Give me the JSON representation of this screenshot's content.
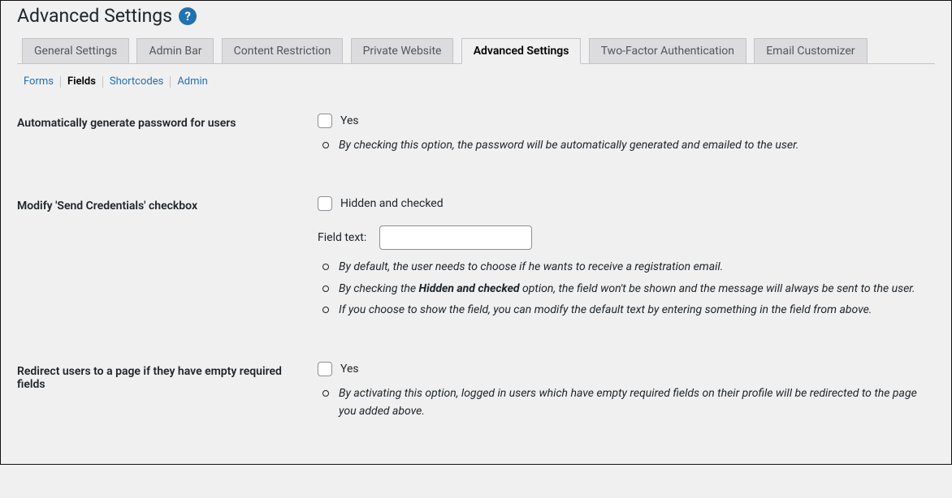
{
  "page": {
    "title": "Advanced Settings"
  },
  "tabs": [
    "General Settings",
    "Admin Bar",
    "Content Restriction",
    "Private Website",
    "Advanced Settings",
    "Two-Factor Authentication",
    "Email Customizer"
  ],
  "active_tab_index": 4,
  "subtabs": [
    "Forms",
    "Fields",
    "Shortcodes",
    "Admin"
  ],
  "active_subtab_index": 1,
  "fields": {
    "auto_pw": {
      "label": "Automatically generate password for users",
      "chk_label": "Yes",
      "desc1": "By checking this option, the password will be automatically generated and emailed to the user."
    },
    "send_cred": {
      "label": "Modify 'Send Credentials' checkbox",
      "chk_label": "Hidden and checked",
      "fieldtext_label": "Field text:",
      "fieldtext_value": "",
      "desc1": "By default, the user needs to choose if he wants to receive a registration email.",
      "desc2_pre": "By checking the ",
      "desc2_bold": "Hidden and checked",
      "desc2_post": " option, the field won't be shown and the message will always be sent to the user.",
      "desc3": "If you choose to show the field, you can modify the default text by entering something in the field from above."
    },
    "redirect_empty": {
      "label": "Redirect users to a page if they have empty required fields",
      "chk_label": "Yes",
      "desc1": "By activating this option, logged in users which have empty required fields on their profile will be redirected to the page you added above."
    }
  }
}
